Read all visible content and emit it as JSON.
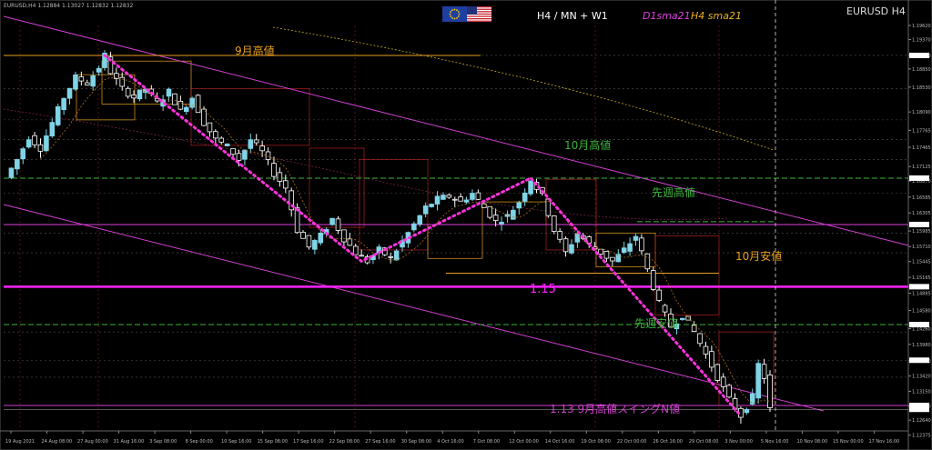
{
  "header": {
    "info": "EURUSD,H4  1.12884 1.13027 1.12832 1.12832",
    "timeframes": "H4 / MN + W1",
    "sma_d1": "D1sma21",
    "sma_h4": "H4 sma21",
    "symbol": "EURUSD H4"
  },
  "flags": [
    "eu-flag-icon",
    "us-flag-icon"
  ],
  "annotations": {
    "sep_high": "9月高値",
    "oct_high": "10月高値",
    "last_week_high": "先週高値",
    "oct_low": "10月安値",
    "level_115": "1.15",
    "last_week_low": "先週安値",
    "bottom_note": "1.13   9月高値スイングN値"
  },
  "colors": {
    "background": "#000000",
    "bull": "#7fd4e6",
    "bear": "#ffffff",
    "magenta": "#ff22ff",
    "orange": "#e8a020",
    "green": "#3cb43c",
    "dotted": "#ff33dd"
  },
  "chart_data": {
    "type": "candlestick",
    "symbol": "EURUSD",
    "timeframe": "H4",
    "ylim": [
      1.1245,
      1.1962
    ],
    "y_ticks": [
      "1.19620",
      "1.19370",
      "1.19090",
      "1.18850",
      "1.18530",
      "1.18090",
      "1.17765",
      "1.17465",
      "1.17125",
      "1.16870",
      "1.16585",
      "1.16305",
      "1.15985",
      "1.15710",
      "1.15445",
      "1.15165",
      "1.14885",
      "1.14580",
      "1.14260",
      "1.13980",
      "1.13690",
      "1.13420",
      "1.13150",
      "1.12890",
      "1.12640",
      "1.12375"
    ],
    "x_ticks": [
      "19 Aug 2021",
      "24 Aug 08:00",
      "27 Aug 00:00",
      "31 Aug 16:00",
      "3 Sep 08:00",
      "8 Sep 00:00",
      "10 Sep 16:00",
      "15 Sep 08:00",
      "17 Sep 16:00",
      "22 Sep 08:00",
      "27 Sep 16:00",
      "30 Sep 08:00",
      "4 Oct 16:00",
      "7 Oct 08:00",
      "12 Oct 00:00",
      "14 Oct 16:00",
      "19 Oct 08:00",
      "22 Oct 00:00",
      "26 Oct 16:00",
      "29 Oct 08:00",
      "3 Nov 00:00",
      "5 Nov 16:00",
      "10 Nov 08:00",
      "15 Nov 00:00",
      "17 Nov 16:00"
    ],
    "price_path": [
      [
        0,
        1.1693
      ],
      [
        2,
        1.1725
      ],
      [
        4,
        1.1765
      ],
      [
        6,
        1.1745
      ],
      [
        8,
        1.179
      ],
      [
        10,
        1.1835
      ],
      [
        12,
        1.187
      ],
      [
        14,
        1.186
      ],
      [
        16,
        1.1888
      ],
      [
        17,
        1.1909
      ],
      [
        18,
        1.188
      ],
      [
        20,
        1.185
      ],
      [
        22,
        1.1835
      ],
      [
        24,
        1.185
      ],
      [
        26,
        1.1825
      ],
      [
        28,
        1.1845
      ],
      [
        30,
        1.181
      ],
      [
        32,
        1.1835
      ],
      [
        34,
        1.179
      ],
      [
        36,
        1.176
      ],
      [
        38,
        1.1748
      ],
      [
        40,
        1.1725
      ],
      [
        42,
        1.176
      ],
      [
        44,
        1.1738
      ],
      [
        46,
        1.17
      ],
      [
        48,
        1.1675
      ],
      [
        50,
        1.16
      ],
      [
        52,
        1.157
      ],
      [
        54,
        1.159
      ],
      [
        56,
        1.162
      ],
      [
        58,
        1.1585
      ],
      [
        60,
        1.156
      ],
      [
        62,
        1.1545
      ],
      [
        64,
        1.1565
      ],
      [
        66,
        1.155
      ],
      [
        68,
        1.158
      ],
      [
        70,
        1.161
      ],
      [
        72,
        1.164
      ],
      [
        74,
        1.1655
      ],
      [
        76,
        1.166
      ],
      [
        78,
        1.165
      ],
      [
        80,
        1.1665
      ],
      [
        82,
        1.164
      ],
      [
        84,
        1.1615
      ],
      [
        86,
        1.1625
      ],
      [
        88,
        1.165
      ],
      [
        90,
        1.169
      ],
      [
        92,
        1.166
      ],
      [
        94,
        1.16
      ],
      [
        96,
        1.156
      ],
      [
        98,
        1.1595
      ],
      [
        100,
        1.1575
      ],
      [
        102,
        1.156
      ],
      [
        104,
        1.1545
      ],
      [
        106,
        1.1565
      ],
      [
        108,
        1.159
      ],
      [
        110,
        1.153
      ],
      [
        112,
        1.147
      ],
      [
        114,
        1.143
      ],
      [
        116,
        1.145
      ],
      [
        118,
        1.142
      ],
      [
        120,
        1.138
      ],
      [
        122,
        1.134
      ],
      [
        124,
        1.13
      ],
      [
        126,
        1.1272
      ],
      [
        128,
        1.1305
      ],
      [
        129,
        1.1362
      ],
      [
        130,
        1.134
      ],
      [
        131,
        1.1283
      ]
    ],
    "levels": [
      {
        "label": "9月高値",
        "price": 1.1909
      },
      {
        "label": "10月高値",
        "price": 1.1692
      },
      {
        "label": "先週高値",
        "price": 1.1615
      },
      {
        "label": "10月安値",
        "price": 1.1524
      },
      {
        "label": "1.15",
        "price": 1.15
      },
      {
        "label": "先週安値",
        "price": 1.1433
      },
      {
        "label": "1.13",
        "price": 1.129
      }
    ],
    "current_price": 1.12832
  }
}
